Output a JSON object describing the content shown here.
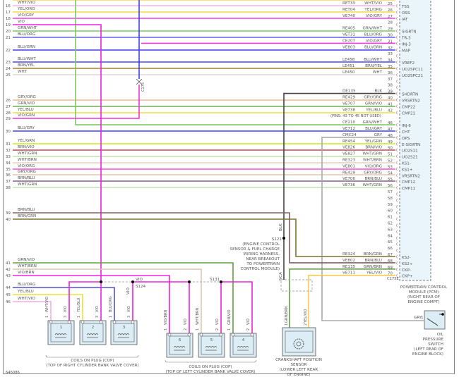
{
  "left_pins": [
    {
      "pin": "16",
      "label": "WHT/VIO",
      "color": "#f4b4ea"
    },
    {
      "pin": "17",
      "label": "YEL/ORG",
      "color": "#f5d847"
    },
    {
      "pin": "18",
      "label": "VIO/GRY",
      "color": "#f03ce0"
    },
    {
      "pin": "19",
      "label": "VIO",
      "color": "#f020e0"
    },
    {
      "pin": "20",
      "label": "GRN/WHT",
      "color": "#7cc860"
    },
    {
      "pin": "21",
      "label": "BLU/ORG",
      "color": "#6060e8"
    },
    {
      "pin": "22",
      "label": "BLU/GRN",
      "color": "#4040f0"
    },
    {
      "pin": "23",
      "label": "BLU/WHT",
      "color": "#4a4af0"
    },
    {
      "pin": "24",
      "label": "BRN/YEL",
      "color": "#a08030"
    },
    {
      "pin": "25",
      "label": "WHT",
      "color": "#d8d8d8"
    },
    {
      "pin": "26",
      "label": "GRY/ORG",
      "color": "#f0b890"
    },
    {
      "pin": "27",
      "label": "GRN/VIO",
      "color": "#6ab050"
    },
    {
      "pin": "28",
      "label": "YEL/BLU",
      "color": "#e8e040"
    },
    {
      "pin": "29",
      "label": "VIO/GRN",
      "color": "#f030e0"
    },
    {
      "pin": "30",
      "label": "BLU/GRY",
      "color": "#4040f0"
    },
    {
      "pin": "31",
      "label": "YEL/GRN",
      "color": "#c8e820"
    },
    {
      "pin": "32",
      "label": "BRN/VIO",
      "color": "#b05050"
    },
    {
      "pin": "33",
      "label": "WHT/GRN",
      "color": "#c0e0b0"
    },
    {
      "pin": "34",
      "label": "WHT/BRN",
      "color": "#e0d0c0"
    },
    {
      "pin": "35",
      "label": "VIO/ORG",
      "color": "#f050d0"
    },
    {
      "pin": "36",
      "label": "GRY/ORG",
      "color": "#e0c8b0"
    },
    {
      "pin": "37",
      "label": "BRN/BLU",
      "color": "#806080"
    },
    {
      "pin": "38",
      "label": "WHT/GRN",
      "color": "#c0e0b0"
    },
    {
      "pin": "39",
      "label": "BRN/BLU",
      "color": "#806060"
    },
    {
      "pin": "40",
      "label": "BRN/GRN",
      "color": "#807030"
    },
    {
      "pin": "41",
      "label": "GRN/VIO",
      "color": "#60a040"
    },
    {
      "pin": "42",
      "label": "WHT/BRN",
      "color": "#d8c8b0"
    },
    {
      "pin": "43",
      "label": "VIO/BRN",
      "color": "#f020e0"
    },
    {
      "pin": "44",
      "label": "BLU/ORG",
      "color": "#5050d0"
    },
    {
      "pin": "45",
      "label": "YEL/BLU",
      "color": "#e8e040"
    },
    {
      "pin": "46",
      "label": "WHT/VIO",
      "color": "#f0b0e0"
    }
  ],
  "right_pins": [
    {
      "pin": "25",
      "circuit": "RET33",
      "wire": "WHT/VIO",
      "func": "TSS",
      "color": "#f4b4ea"
    },
    {
      "pin": "26",
      "circuit": "RET04",
      "wire": "YEL/ORG",
      "func": "OSS",
      "color": "#f5d847"
    },
    {
      "pin": "27",
      "circuit": "VE740",
      "wire": "VIO/GRY",
      "func": "IAT",
      "color": "#f03ce0"
    },
    {
      "pin": "28",
      "circuit": "",
      "wire": "",
      "func": "",
      "color": ""
    },
    {
      "pin": "29",
      "circuit": "RE405",
      "wire": "GRN/WHT",
      "func": "SIGRTN",
      "color": "#7cc860"
    },
    {
      "pin": "30",
      "circuit": "VET31",
      "wire": "BLU/ORG",
      "func": "TR-3",
      "color": "#6060e8"
    },
    {
      "pin": "31",
      "circuit": "CE207",
      "wire": "VIO/GRY",
      "func": "INJ-3",
      "color": "#f03ce0"
    },
    {
      "pin": "32",
      "circuit": "VE803",
      "wire": "BLU/GRN",
      "func": "MAP",
      "color": "#4040f0"
    },
    {
      "pin": "33",
      "circuit": "",
      "wire": "",
      "func": "",
      "color": ""
    },
    {
      "pin": "34",
      "circuit": "LE458",
      "wire": "BLU/WHT",
      "func": "VREF2",
      "color": "#4a4af0"
    },
    {
      "pin": "35",
      "circuit": "LE451",
      "wire": "BRN/YEL",
      "func": "UO2SPC11",
      "color": "#a08030"
    },
    {
      "pin": "36",
      "circuit": "LE450",
      "wire": "WHT",
      "func": "UO2SPC21",
      "color": "#d8d8d8"
    },
    {
      "pin": "37",
      "circuit": "",
      "wire": "",
      "func": "",
      "color": ""
    },
    {
      "pin": "38",
      "circuit": "",
      "wire": "",
      "func": "",
      "color": ""
    },
    {
      "pin": "39",
      "circuit": "DE135",
      "wire": "BLK",
      "func": "SHDRTN",
      "color": "#555555"
    },
    {
      "pin": "40",
      "circuit": "RE429",
      "wire": "GRY/ORG",
      "func": "VRSRTN2",
      "color": "#f0b890"
    },
    {
      "pin": "41",
      "circuit": "VE707",
      "wire": "GRN/VIO",
      "func": "CMP22",
      "color": "#6ab050"
    },
    {
      "pin": "42",
      "circuit": "VE738",
      "wire": "YEL/BLU",
      "func": "CMP21",
      "color": "#e8e040"
    },
    {
      "pin": "",
      "circuit": "(PINS: 43 TO 45 NOT USED)",
      "wire": "",
      "func": "",
      "color": ""
    },
    {
      "pin": "46",
      "circuit": "CE210",
      "wire": "GRN/WHT",
      "func": "INJ-6",
      "color": "#7cc860"
    },
    {
      "pin": "47",
      "circuit": "VE712",
      "wire": "BLU/GRY",
      "func": "CHT",
      "color": "#4040f0"
    },
    {
      "pin": "48",
      "circuit": "CMC24",
      "wire": "GRY",
      "func": "OPS",
      "color": "#aaaaaa"
    },
    {
      "pin": "49",
      "circuit": "RE454",
      "wire": "YEL/GRN",
      "func": "E-SIGRTN",
      "color": "#c8e820"
    },
    {
      "pin": "50",
      "circuit": "VE826",
      "wire": "BRN/VIO",
      "func": "UO2S11",
      "color": "#b05050"
    },
    {
      "pin": "51",
      "circuit": "VE827",
      "wire": "WHT/GRN",
      "func": "UO2S21",
      "color": "#c0e0b0"
    },
    {
      "pin": "52",
      "circuit": "RE323",
      "wire": "WHT/BRN",
      "func": "KS1-",
      "color": "#e0d0c0"
    },
    {
      "pin": "53",
      "circuit": "VE801",
      "wire": "VIO/ORG",
      "func": "KS1+",
      "color": "#f050d0"
    },
    {
      "pin": "54",
      "circuit": "RE429",
      "wire": "GRY/ORG",
      "func": "VRSRTN2",
      "color": "#e0c8b0"
    },
    {
      "pin": "55",
      "circuit": "VE706",
      "wire": "BRN/BLU",
      "func": "CMP12",
      "color": "#806080"
    },
    {
      "pin": "56",
      "circuit": "VE736",
      "wire": "WHT/GRN",
      "func": "CMP11",
      "color": "#c0e0b0"
    },
    {
      "pin": "57",
      "circuit": "",
      "wire": "",
      "func": "",
      "color": ""
    },
    {
      "pin": "58",
      "circuit": "",
      "wire": "",
      "func": "",
      "color": ""
    },
    {
      "pin": "59",
      "circuit": "",
      "wire": "",
      "func": "",
      "color": ""
    },
    {
      "pin": "60",
      "circuit": "",
      "wire": "",
      "func": "",
      "color": ""
    },
    {
      "pin": "61",
      "circuit": "",
      "wire": "",
      "func": "",
      "color": ""
    },
    {
      "pin": "62",
      "circuit": "",
      "wire": "",
      "func": "",
      "color": ""
    },
    {
      "pin": "63",
      "circuit": "",
      "wire": "",
      "func": "",
      "color": ""
    },
    {
      "pin": "64",
      "circuit": "",
      "wire": "",
      "func": "",
      "color": ""
    },
    {
      "pin": "65",
      "circuit": "",
      "wire": "",
      "func": "",
      "color": ""
    },
    {
      "pin": "66",
      "circuit": "",
      "wire": "",
      "func": "",
      "color": ""
    },
    {
      "pin": "67",
      "circuit": "RE324",
      "wire": "BRN/GRN",
      "func": "KS2-",
      "color": "#807030"
    },
    {
      "pin": "68",
      "circuit": "VE802",
      "wire": "BRN/BLU",
      "func": "KS2+",
      "color": "#806060"
    },
    {
      "pin": "69",
      "circuit": "RE135",
      "wire": "GRN/BRN",
      "func": "CKP-",
      "color": "#60a040"
    },
    {
      "pin": "70",
      "circuit": "VE711",
      "wire": "YEL/VIO",
      "func": "CKP+",
      "color": "#f5c850"
    }
  ],
  "connector": {
    "pcm": "C175E",
    "inline": "C175"
  },
  "pcm_label": [
    "POWERTRAIN CONTROL",
    "MODULE (PCM)",
    "(RIGHT REAR OF",
    "ENGINE COMPT)"
  ],
  "splice_s121": {
    "id": "S121",
    "desc": [
      "(ENGINE CONTROL",
      "SENSOR & FUEL CHARGE",
      "WIRING HARNESS,",
      "NEAR BREAKOUT",
      "TO POWERTRAIN",
      "CONTROL MODULE)"
    ],
    "wire": "BLK",
    "nca": "NCA"
  },
  "bus": {
    "label": "VIO",
    "s124": "S124",
    "s131": "S131",
    "drop_label": "VIO"
  },
  "crank": {
    "wire1": "GRN/BRN",
    "wire2": "YEL/VIO",
    "pin1": "1",
    "pin2": "2",
    "label": [
      "CRANKSHAFT POSITION",
      "SENSOR",
      "(LOWER LEFT REAR",
      "OF ENGINE)"
    ]
  },
  "oil": {
    "wire": "GRY",
    "pin": "1",
    "label": [
      "OIL",
      "PRESSURE",
      "SWITCH",
      "(LEFT REAR OF",
      "ENGINE BLOCK)"
    ]
  },
  "coils_right": {
    "title": "COILS ON PLUG (COP)",
    "location": "(TOP OF RIGHT CYLINDER BANK VALVE COVER)",
    "coils": [
      {
        "num": "1",
        "w1": "WHT/VIO",
        "w2": "VIO",
        "p1": "1",
        "p2": "3"
      },
      {
        "num": "2",
        "w1": "YEL/BLU",
        "w2": "VIO",
        "p1": "1",
        "p2": "3"
      },
      {
        "num": "3",
        "w1": "BLU/ORG",
        "w2": "VIO",
        "p1": "1",
        "p2": "3"
      }
    ]
  },
  "coils_left": {
    "title": "COILS ON PLUG (COP)",
    "location": "(TOP OF LEFT CYLINDER BANK VALVE COVER)",
    "coils": [
      {
        "num": "6",
        "w1": "VIO/BRN",
        "w2": "VIO",
        "p1": "1",
        "p2": "2"
      },
      {
        "num": "5",
        "w1": "WHT/BRN",
        "w2": "VIO",
        "p1": "1",
        "p2": "2"
      },
      {
        "num": "4",
        "w1": "GRN/VIO",
        "w2": "VIO",
        "p1": "1",
        "p2": "2"
      }
    ]
  },
  "figure_id": "646086"
}
